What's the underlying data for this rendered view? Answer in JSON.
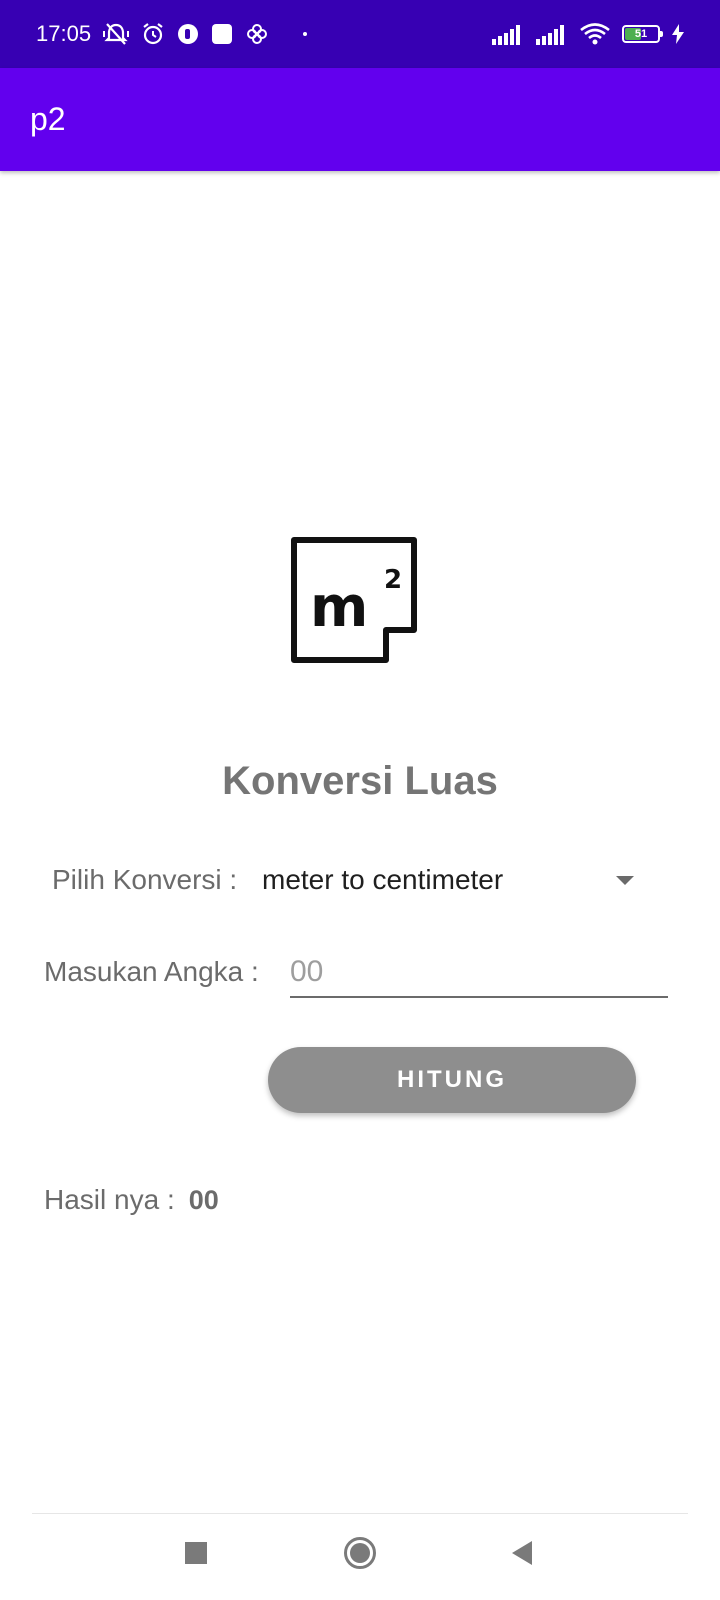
{
  "status_bar": {
    "time": "17:05",
    "battery_level": "51",
    "icons": [
      "mute-vibrate-icon",
      "alarm-icon",
      "app-notification-icon",
      "square-notification-icon",
      "pinwheel-icon",
      "signal-1-icon",
      "signal-2-icon",
      "wifi-icon",
      "battery-icon",
      "charging-icon"
    ],
    "battery_fill_color": "#4caf50",
    "background_color": "#3700b3"
  },
  "app_bar": {
    "title": "p2",
    "background_color": "#6200ee"
  },
  "logo": {
    "icon": "square-meter-icon",
    "text": "m²"
  },
  "main": {
    "heading": "Konversi Luas",
    "conversion_label": "Pilih Konversi :",
    "conversion_selected": "meter to centimeter",
    "input_label": "Masukan Angka :",
    "input_value": "",
    "input_placeholder": "00",
    "button_label": "HITUNG",
    "button_color": "#8e8e8e",
    "result_label": "Hasil nya :",
    "result_value": "00"
  },
  "nav_bar": {
    "icons": [
      "recent-apps-icon",
      "home-icon",
      "back-icon"
    ]
  }
}
